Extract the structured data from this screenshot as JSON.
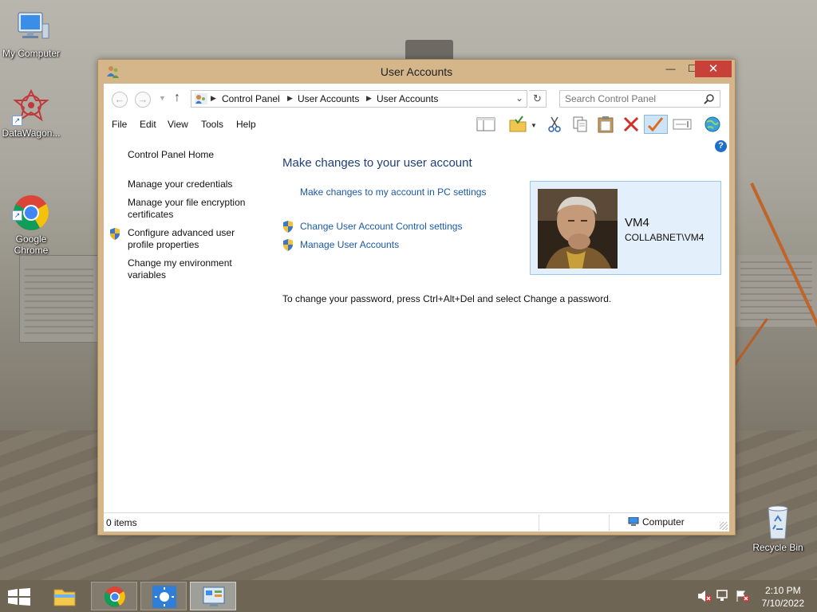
{
  "desktop": {
    "icons": [
      {
        "label": "My Computer"
      },
      {
        "label": "DataWagon..."
      },
      {
        "label": "Google\nChrome"
      },
      {
        "label": "Recycle Bin"
      }
    ]
  },
  "window": {
    "title": "User Accounts",
    "controls": {
      "minimize": "—",
      "maximize": "☐",
      "close": "✕"
    }
  },
  "address": {
    "crumbs": [
      "Control Panel",
      "User Accounts",
      "User Accounts"
    ],
    "search_placeholder": "Search Control Panel"
  },
  "menu": [
    "File",
    "Edit",
    "View",
    "Tools",
    "Help"
  ],
  "left_nav": {
    "home": "Control Panel Home",
    "links": [
      "Manage your credentials",
      "Manage your file encryption certificates",
      "Configure advanced user profile properties",
      "Change my environment variables"
    ]
  },
  "content": {
    "title": "Make changes to your user account",
    "pc_settings_link": "Make changes to my account in PC settings",
    "uac_link": "Change User Account Control settings",
    "manage_link": "Manage User Accounts",
    "password_note": "To change your password, press Ctrl+Alt+Del and select Change a password."
  },
  "user": {
    "name": "VM4",
    "domain": "COLLABNET\\VM4"
  },
  "status": {
    "items": "0 items",
    "zone": "Computer"
  },
  "clock": {
    "time": "2:10 PM",
    "date": "7/10/2022"
  },
  "colors": {
    "window_frame": "#d4b68a",
    "close_button": "#c7403a",
    "link": "#1a59a8",
    "heading": "#1e3f7a",
    "user_card": "#e3f0fb"
  }
}
